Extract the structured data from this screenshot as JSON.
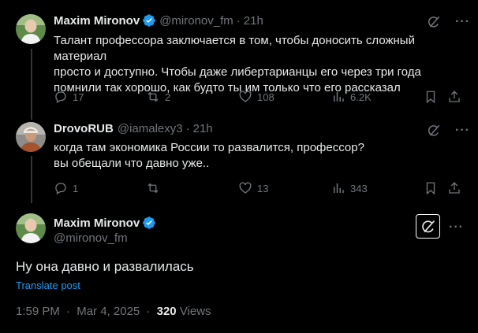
{
  "tweets": [
    {
      "author": "Maxim Mironov",
      "handle": "@mironov_fm",
      "time": "21h",
      "text_lines": [
        "Талант профессора заключается в том, чтобы доносить сложный материал",
        "просто и доступно. Чтобы даже либертарианцы его через три года",
        "помнили так хорошо, как будто ты им только что его рассказал"
      ],
      "replies": "17",
      "reposts": "2",
      "likes": "108",
      "views": "6.2K"
    },
    {
      "author": "DrovoRUB",
      "handle": "@iamalexy3",
      "time": "21h",
      "text_lines": [
        "когда там экономика России то развалится, профессор?",
        "вы обещали что давно уже.."
      ],
      "replies": "1",
      "reposts": "",
      "likes": "13",
      "views": "343"
    }
  ],
  "main": {
    "author": "Maxim Mironov",
    "handle": "@mironov_fm",
    "text": "Ну она давно и развалилась",
    "translate_label": "Translate post",
    "time": "1:59 PM",
    "date": "Mar 4, 2025",
    "views_count": "320",
    "views_label": "Views"
  },
  "separator": "·",
  "colors": {
    "background": "#000000",
    "text": "#e7e9ea",
    "muted": "#71767b",
    "accent": "#1d9bf0",
    "thread_line": "#333639"
  },
  "icons": [
    "grok-icon",
    "more-icon",
    "reply-icon",
    "repost-icon",
    "like-icon",
    "views-icon",
    "bookmark-icon",
    "share-icon",
    "verified-icon"
  ]
}
